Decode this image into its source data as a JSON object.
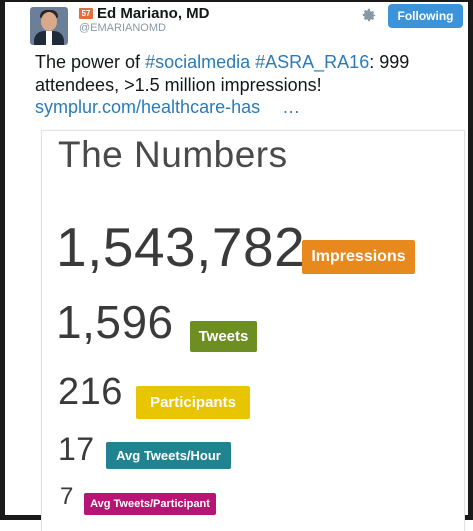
{
  "tweet": {
    "author_name": "Ed Mariano, MD",
    "author_handle": "@EMARIANOMD",
    "badge": "57",
    "follow_label": "Following",
    "text_prefix": "The power of ",
    "hashtag_1": "#socialmedia",
    "hashtag_2": "#ASRA_RA16",
    "text_suffix": ": 999 attendees, >1.5 million impressions!",
    "link": "symplur.com/healthcare-has",
    "ellipsis": "…"
  },
  "card": {
    "title": "The Numbers",
    "stats": [
      {
        "value": "1,543,782",
        "label": "Impressions",
        "color": "#e8891e"
      },
      {
        "value": "1,596",
        "label": "Tweets",
        "color": "#6d8e22"
      },
      {
        "value": "216",
        "label": "Participants",
        "color": "#e8c500"
      },
      {
        "value": "17",
        "label": "Avg Tweets/Hour",
        "color": "#20838f"
      },
      {
        "value": "7",
        "label": "Avg Tweets/Participant",
        "color": "#b71575"
      }
    ]
  },
  "icons": {
    "gear": "gear-icon",
    "avatar": "avatar"
  }
}
